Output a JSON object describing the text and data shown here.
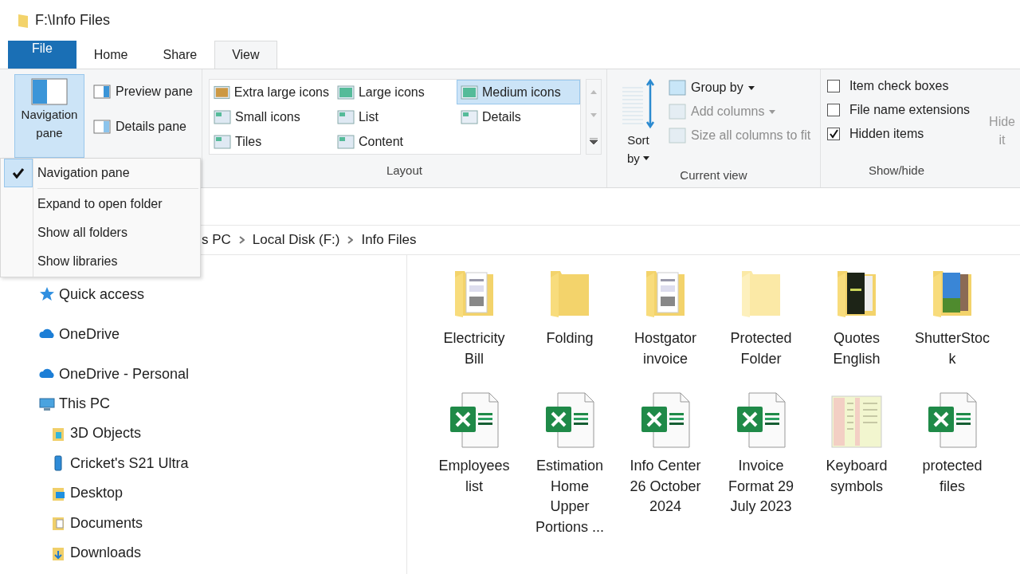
{
  "window": {
    "title": "F:\\Info Files"
  },
  "tabs": [
    {
      "label": "File",
      "kind": "file",
      "selected": false
    },
    {
      "label": "Home",
      "kind": "tab",
      "selected": false
    },
    {
      "label": "Share",
      "kind": "tab",
      "selected": false
    },
    {
      "label": "View",
      "kind": "tab",
      "selected": true
    }
  ],
  "ribbon": {
    "panes": {
      "navigation_button": {
        "lines": [
          "Navigation",
          "pane"
        ],
        "selected": true
      },
      "items": [
        "Preview pane",
        "Details pane"
      ]
    },
    "layout": {
      "label": "Layout",
      "items": [
        {
          "label": "Extra large icons",
          "selected": false
        },
        {
          "label": "Large icons",
          "selected": false
        },
        {
          "label": "Medium icons",
          "selected": true
        },
        {
          "label": "Small icons",
          "selected": false
        },
        {
          "label": "List",
          "selected": false
        },
        {
          "label": "Details",
          "selected": false
        },
        {
          "label": "Tiles",
          "selected": false
        },
        {
          "label": "Content",
          "selected": false
        }
      ]
    },
    "current_view": {
      "label": "Current view",
      "sort_button": {
        "lines": [
          "Sort",
          "by"
        ]
      },
      "items": [
        {
          "label": "Group by",
          "disabled": false,
          "dropdown": true
        },
        {
          "label": "Add columns",
          "disabled": true,
          "dropdown": true
        },
        {
          "label": "Size all columns to fit",
          "disabled": true,
          "dropdown": false
        }
      ]
    },
    "show_hide": {
      "label": "Show/hide",
      "checkboxes": [
        {
          "label": "Item check boxes",
          "checked": false
        },
        {
          "label": "File name extensions",
          "checked": false
        },
        {
          "label": "Hidden items",
          "checked": true
        }
      ],
      "hide_button": {
        "lines": [
          "Hide",
          "it"
        ],
        "disabled": true
      }
    }
  },
  "navigation_menu": [
    {
      "label": "Navigation pane",
      "checked": true
    },
    {
      "label": "Expand to open folder",
      "checked": false
    },
    {
      "label": "Show all folders",
      "checked": false
    },
    {
      "label": "Show libraries",
      "checked": false
    }
  ],
  "address_bar": {
    "crumbs": [
      "s PC",
      "Local Disk (F:)",
      "Info Files"
    ]
  },
  "navigation_pane": [
    {
      "label": "Quick access",
      "kind": "star"
    },
    {
      "label": "OneDrive",
      "kind": "cloud"
    },
    {
      "label": "OneDrive - Personal",
      "kind": "cloud"
    },
    {
      "label": "This PC",
      "kind": "pc",
      "children": [
        {
          "label": "3D Objects",
          "kind": "cube"
        },
        {
          "label": "Cricket's S21 Ultra",
          "kind": "phone"
        },
        {
          "label": "Desktop",
          "kind": "desktop"
        },
        {
          "label": "Documents",
          "kind": "documents"
        },
        {
          "label": "Downloads",
          "kind": "downloads"
        }
      ]
    }
  ],
  "files": [
    {
      "name": "Electricity Bill",
      "kind": "folder_docs"
    },
    {
      "name": "Folding",
      "kind": "folder"
    },
    {
      "name": "Hostgator invoice",
      "kind": "folder_docs"
    },
    {
      "name": "Protected Folder",
      "kind": "folder_pale"
    },
    {
      "name": "Quotes English",
      "kind": "folder_dark"
    },
    {
      "name": "ShutterStock",
      "kind": "folder_photo"
    },
    {
      "name": "Employees list",
      "kind": "excel"
    },
    {
      "name": "Estimation Home Upper Portions ...",
      "kind": "excel"
    },
    {
      "name": "Info Center 26 October 2024",
      "kind": "excel"
    },
    {
      "name": "Invoice Format 29 July 2023",
      "kind": "excel"
    },
    {
      "name": "Keyboard symbols",
      "kind": "image"
    },
    {
      "name": "protected files",
      "kind": "excel"
    }
  ]
}
